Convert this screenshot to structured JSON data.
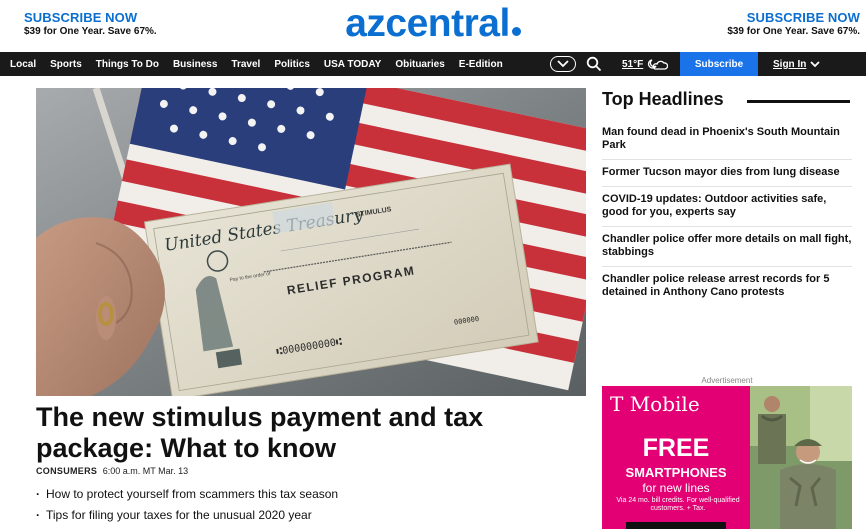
{
  "header": {
    "subscribe_left": {
      "title": "SUBSCRIBE NOW",
      "offer": "$39 for One Year. Save 67%."
    },
    "subscribe_right": {
      "title": "SUBSCRIBE NOW",
      "offer": "$39 for One Year. Save 67%."
    },
    "logo": "azcentral"
  },
  "nav": {
    "items": [
      "Local",
      "Sports",
      "Things To Do",
      "Business",
      "Travel",
      "Politics",
      "USA TODAY",
      "Obituaries",
      "E-Edition"
    ],
    "more_icon": "chevron-circle-icon",
    "search_icon": "search-icon",
    "weather": "51°F",
    "weather_icon": "cloudy-moon-icon",
    "subscribe": "Subscribe",
    "signin": "Sign In"
  },
  "hero": {
    "check_issuer": "United States Treasury",
    "check_stamp": "STIMULUS",
    "check_text": "RELIEF PROGRAM",
    "check_pay": "Pay to the order of",
    "check_number": "⑆000000000⑆",
    "check_code": "000000"
  },
  "article": {
    "headline": "The new stimulus payment and tax package: What to know",
    "category": "CONSUMERS",
    "timestamp": "6:00 a.m. MT Mar. 13",
    "bullets": [
      "How to protect yourself from scammers this tax season",
      "Tips for filing your taxes for the unusual 2020 year"
    ]
  },
  "sidebar": {
    "title": "Top Headlines",
    "headlines": [
      "Man found dead in Phoenix's South Mountain Park",
      "Former Tucson mayor dies from lung disease",
      "COVID-19 updates: Outdoor activities safe, good for you, experts say",
      "Chandler police offer more details on mall fight, stabbings",
      "Chandler police release arrest records for 5 detained in Anthony Cano protests"
    ],
    "ad_label": "Advertisement",
    "ad": {
      "brand": "T Mobile",
      "headline": "FREE",
      "subhead": "SMARTPHONES",
      "tagline": "for new lines",
      "fine_print": "Via 24 mo. bill credits. For well-qualified customers. + Tax."
    }
  },
  "colors": {
    "brand_blue": "#0a6fd0",
    "nav_bg": "#1a1a1a",
    "subscribe_btn": "#1a73e8",
    "ad_magenta": "#e20074"
  }
}
